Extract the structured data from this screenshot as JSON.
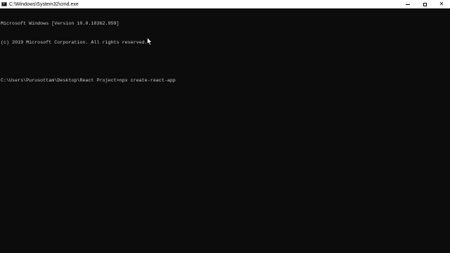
{
  "window": {
    "title": "C:\\Windows\\System32\\cmd.exe",
    "controls": {
      "minimize_icon": "minimize-icon",
      "maximize_icon": "maximize-icon",
      "close_glyph": "✕"
    }
  },
  "console": {
    "lines": [
      "Microsoft Windows [Version 10.0.18362.959]",
      "(c) 2019 Microsoft Corporation. All rights reserved.",
      "",
      "C:\\Users\\Purusottam\\Desktop\\React Project>npx create-react-app"
    ],
    "colors": {
      "background": "#0c0c0c",
      "text": "#cccccc"
    }
  }
}
